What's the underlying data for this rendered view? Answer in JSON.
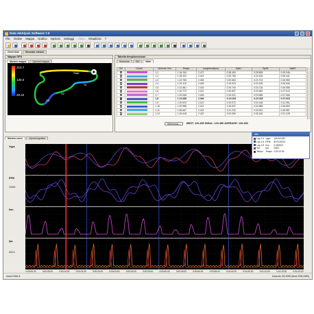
{
  "window": {
    "title": "Data ANAlysis Software 7.0",
    "controls": [
      "_",
      "□",
      "x"
    ]
  },
  "menu": [
    {
      "label": "File",
      "disabled": false
    },
    {
      "label": "Ordine",
      "disabled": false
    },
    {
      "label": "Mappa",
      "disabled": false
    },
    {
      "label": "Grafico",
      "disabled": false
    },
    {
      "label": "Opzioni",
      "disabled": false
    },
    {
      "label": "Settaggi",
      "disabled": false
    },
    {
      "label": "Video",
      "disabled": true
    },
    {
      "label": "Visualizza",
      "disabled": false
    },
    {
      "label": "?",
      "disabled": false
    }
  ],
  "toolbar_icons": [
    "open-folder-icon",
    "save-icon",
    "flag-icon",
    "flag-icon",
    "flag-icon",
    "flag-icon",
    "zoom-in-icon",
    "zoom-out-icon",
    "zoom-fit-icon",
    "zoom-reset-icon",
    "zoom-all-icon",
    "pan-icon",
    "chart-view-icon",
    "chart-view-icon",
    "chart-view-icon",
    "chart-view-icon",
    "chart-view-icon",
    "chart-view-icon",
    "zoom-in-icon",
    "zoom-out-icon",
    "zoom-fit-icon",
    "zoom-reset-icon",
    "zoom-all-icon",
    "pan-icon",
    "help-icon",
    "info-icon",
    "info-icon",
    "settings-icon"
  ],
  "top_tabs": [
    {
      "label": "Overview",
      "active": true
    },
    {
      "label": "Session viewer",
      "active": false
    }
  ],
  "gps_panel": {
    "title": "Mappa GPS",
    "tabs": [
      {
        "label": "Mostra mappa",
        "active": true
      },
      {
        "label": "Opzioni mappa",
        "active": false
      }
    ],
    "scale_values": [
      "210.7",
      "130.0",
      "49.42"
    ],
    "markers": [
      "Start",
      "S1",
      "S2",
      "S3"
    ]
  },
  "table_panel": {
    "title": "Tabella tempi/sessione",
    "tabs": [
      {
        "label": "Sessione",
        "active": false
      },
      {
        "label": "Giri",
        "active": false
      },
      {
        "label": "Note",
        "active": true
      }
    ],
    "columns": [
      "Sel",
      "Colore",
      "Sezione Giro",
      "Tempo",
      "Lunghezza(km)",
      "Split1",
      "Split2",
      "Split3"
    ],
    "rows": [
      {
        "sel": false,
        "color": "#cc55cc",
        "lap": "1-1",
        "time": "1:34.154",
        "len": "2.472",
        "s1": "0:38.490",
        "s2": "0:28.855",
        "s3": "0:26.946",
        "best": false
      },
      {
        "sel": false,
        "color": "#5599ee",
        "lap": "1-2",
        "time": "1:28.102",
        "len": "2.414",
        "s1": "0:20.765",
        "s2": "0:24.418",
        "s3": "0:26.441",
        "best": false
      },
      {
        "sel": false,
        "color": "#5bb04a",
        "lap": "1-3",
        "time": "1:22.765",
        "len": "2.406",
        "s1": "0:20.660",
        "s2": "0:24.704",
        "s3": "0:26.980",
        "best": false
      },
      {
        "sel": false,
        "color": "#7c3cc8",
        "lap": "1-4",
        "time": "1:22.119",
        "len": "2.409",
        "s1": "0:19.923",
        "s2": "0:23.325",
        "s3": "0:26.906",
        "best": false
      },
      {
        "sel": false,
        "color": "#c03b3b",
        "lap": "1-5",
        "time": "1:21.561",
        "len": "2.424",
        "s1": "0:19.740",
        "s2": "0:24.716",
        "s3": "0:26.956",
        "best": false
      },
      {
        "sel": false,
        "color": "#e07ac8",
        "lap": "1-6",
        "time": "1:20.772",
        "len": "2.421",
        "s1": "0:20.837",
        "s2": "0:23.652",
        "s3": "0:27.010",
        "best": false
      },
      {
        "sel": false,
        "color": "#c06bd2",
        "lap": "1-7",
        "time": "1:20.946",
        "len": "2.405",
        "s1": "0:19.921",
        "s2": "0:23.985",
        "s3": "0:27.066",
        "best": false
      },
      {
        "sel": true,
        "color": "#4f50c4",
        "lap": "1-8",
        "time": "1:20.456",
        "len": "2.406",
        "s1": "0:19.105",
        "s2": "0:23.263",
        "s3": "0:27.003",
        "best": true
      },
      {
        "sel": false,
        "color": "#3ec43e",
        "lap": "1-9",
        "time": "1:20.923",
        "len": "2.437",
        "s1": "0:19.972",
        "s2": "0:24.148",
        "s3": "0:41.951",
        "best": false
      },
      {
        "sel": false,
        "color": "#3a5ed0",
        "lap": "1-10",
        "time": "1:20.958",
        "len": "2.421",
        "s1": "0:19.937",
        "s2": "0:24.685",
        "s3": "0:26.893",
        "best": false
      },
      {
        "sel": false,
        "color": "#48a8e0",
        "lap": "1-11",
        "time": "1:55.467",
        "len": "2.424",
        "s1": "0:21.232",
        "s2": "0:33.251",
        "s3": "0:26.987",
        "best": false
      },
      {
        "sel": false,
        "color": "#8ad06a",
        "lap": "1-12",
        "time": "1:24.618",
        "len": "2.422",
        "s1": "0:20.050",
        "s2": "0:26.440",
        "s3": "0:21.128",
        "best": false
      }
    ],
    "select_button": "Seleziona...",
    "best_text": "BEST: 120.450 IDEAL: 120.450 AVERAGE: 120.450"
  },
  "charts_panel": {
    "tabs": [
      {
        "label": "Mostra curve",
        "active": true
      },
      {
        "label": "Opzioni grafico",
        "active": false
      }
    ],
    "channels": [
      {
        "name": "Vgps",
        "value": ""
      },
      {
        "name": "RPM",
        "value": "10000"
      },
      {
        "name": "Ilon.",
        "value": ""
      },
      {
        "name": "Ipa.",
        "value": "300.5"
      }
    ],
    "x_ticks": [
      "0:00:00.00",
      "0:00:05.00",
      "0:00:10.00",
      "0:00:15.00",
      "0:00:20.00",
      "0:00:25.00",
      "0:00:30.00",
      "0:00:35.00",
      "0:00:40.00",
      "0:00:45.00",
      "0:00:50.00",
      "0:00:55.00",
      "0:01:00.00",
      "0:01:05.00",
      "0:01:10.00",
      "0:01:15.00",
      "0:01:20.00"
    ],
    "cursor_time_fraction": 0.146,
    "blue_marker_fractions": [
      0.22,
      0.48,
      0.73
    ]
  },
  "legend": {
    "title": "Info",
    "rows": [
      {
        "name": "Lap 1-3",
        "channel": "Vgps",
        "value": "106.341042",
        "color": "#cc3333"
      },
      {
        "name": "Lap 1-8",
        "channel": "RPM",
        "value": "8275.29101",
        "color": "#3355cc"
      },
      {
        "name": "Lap 1-8",
        "channel": "Ilon.",
        "value": "0.000000",
        "color": "#cc55cc"
      },
      {
        "name": "Sel.",
        "channel": "Ipa.",
        "value": "208.0",
        "color": "#dd6622"
      },
      {
        "name": "Tempo",
        "channel": "Tempo",
        "value": "0:00:13.09",
        "color": "#222222"
      }
    ]
  },
  "status": {
    "left": "www.DMA.it",
    "right": "Usando 33,2MB (Max 508,1MB)"
  }
}
